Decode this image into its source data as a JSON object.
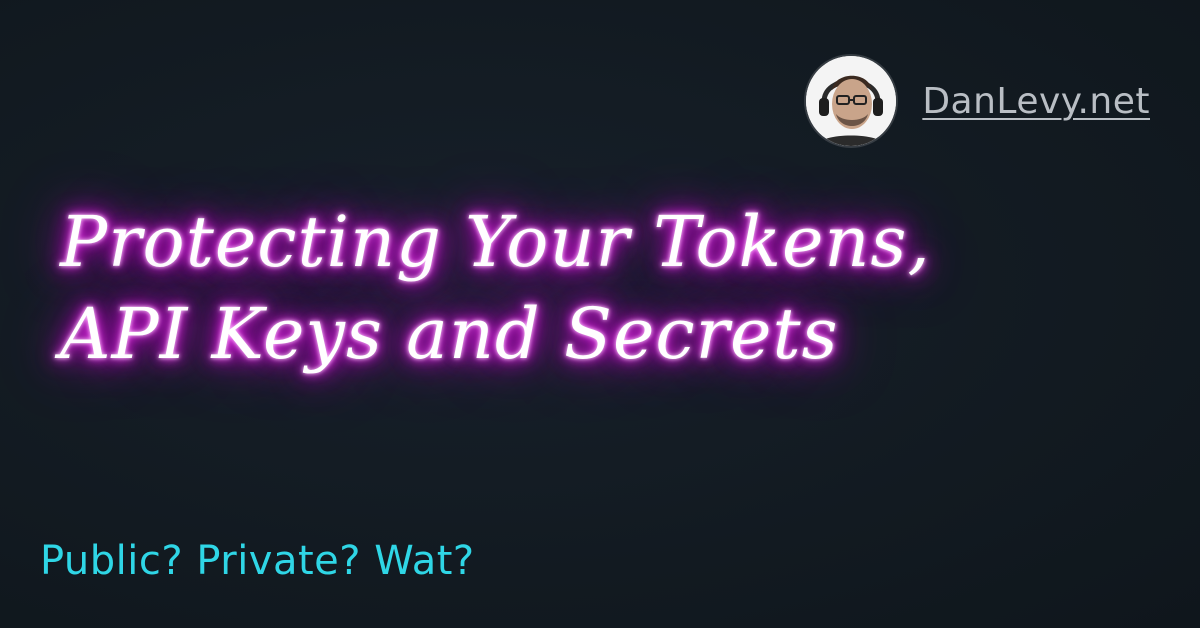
{
  "header": {
    "avatar_alt": "Dan Levy portrait",
    "site_link": "DanLevy.net"
  },
  "title": {
    "line1": "Protecting Your Tokens,",
    "line2": "API Keys and Secrets"
  },
  "subtitle": "Public? Private? Wat?",
  "colors": {
    "background": "#121a21",
    "title_glow": "#e100e6",
    "subtitle": "#2fd6e6",
    "link": "#b9bec4"
  }
}
